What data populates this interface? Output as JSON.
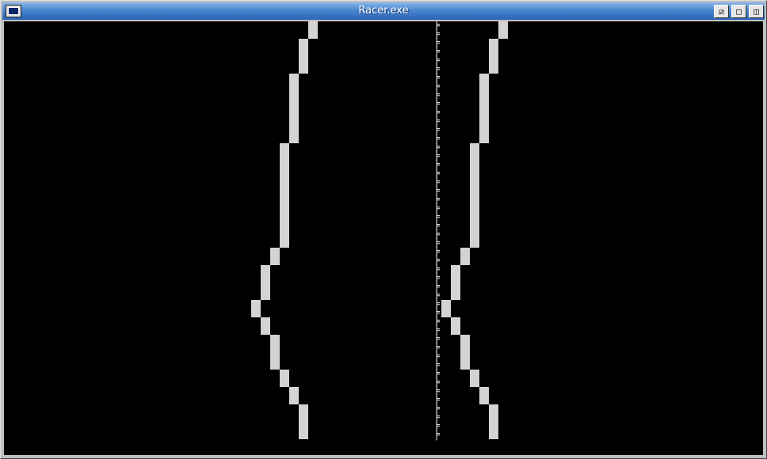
{
  "window": {
    "title": "Racer.exe",
    "icons": {
      "system_menu": "app-window-icon",
      "button_1": "resize-icon",
      "button_2": "maximize-icon",
      "button_3": "restore-icon"
    },
    "button_glyphs": [
      "⧄",
      "□",
      "◫"
    ]
  },
  "game": {
    "median_glyph": "╞",
    "colors": {
      "background": "#000000",
      "road_edge": "#d3d3d3",
      "median": "#e6e6e6"
    }
  }
}
